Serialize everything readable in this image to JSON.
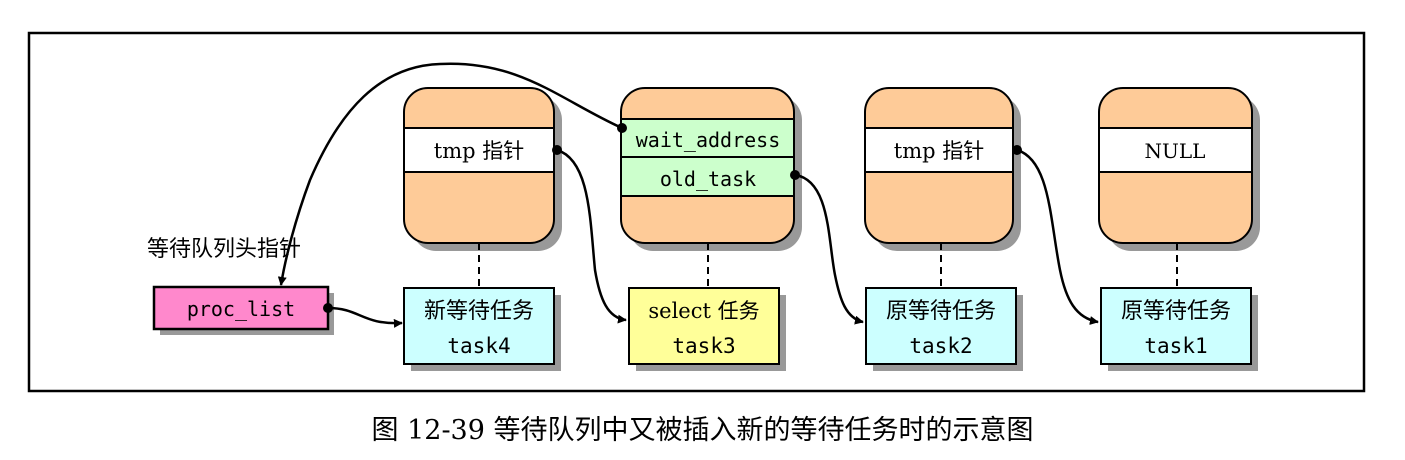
{
  "colors": {
    "stack_fill": "#fecb98",
    "field_fill": "#ffffff",
    "field_fill_current": "#ccffcc",
    "task_fill": "#ccffff",
    "task_fill_current": "#ffff99",
    "head_fill": "#ff88cc",
    "shadow": "#999999",
    "line": "#000000"
  },
  "diagram": {
    "head_label": "等待队列头指针",
    "head_pointer": "proc_list",
    "stacks": [
      {
        "fields": [
          "tmp 指针"
        ]
      },
      {
        "fields": [
          "wait_address",
          "old_task"
        ]
      },
      {
        "fields": [
          "tmp 指针"
        ]
      },
      {
        "fields": [
          "NULL"
        ]
      }
    ],
    "tasks": [
      {
        "line1": "新等待任务",
        "line2": "task4"
      },
      {
        "line1": "select 任务",
        "line2": "task3"
      },
      {
        "line1": "原等待任务",
        "line2": "task2"
      },
      {
        "line1": "原等待任务",
        "line2": "task1"
      }
    ]
  },
  "caption": "图 12-39 等待队列中又被插入新的等待任务时的示意图"
}
